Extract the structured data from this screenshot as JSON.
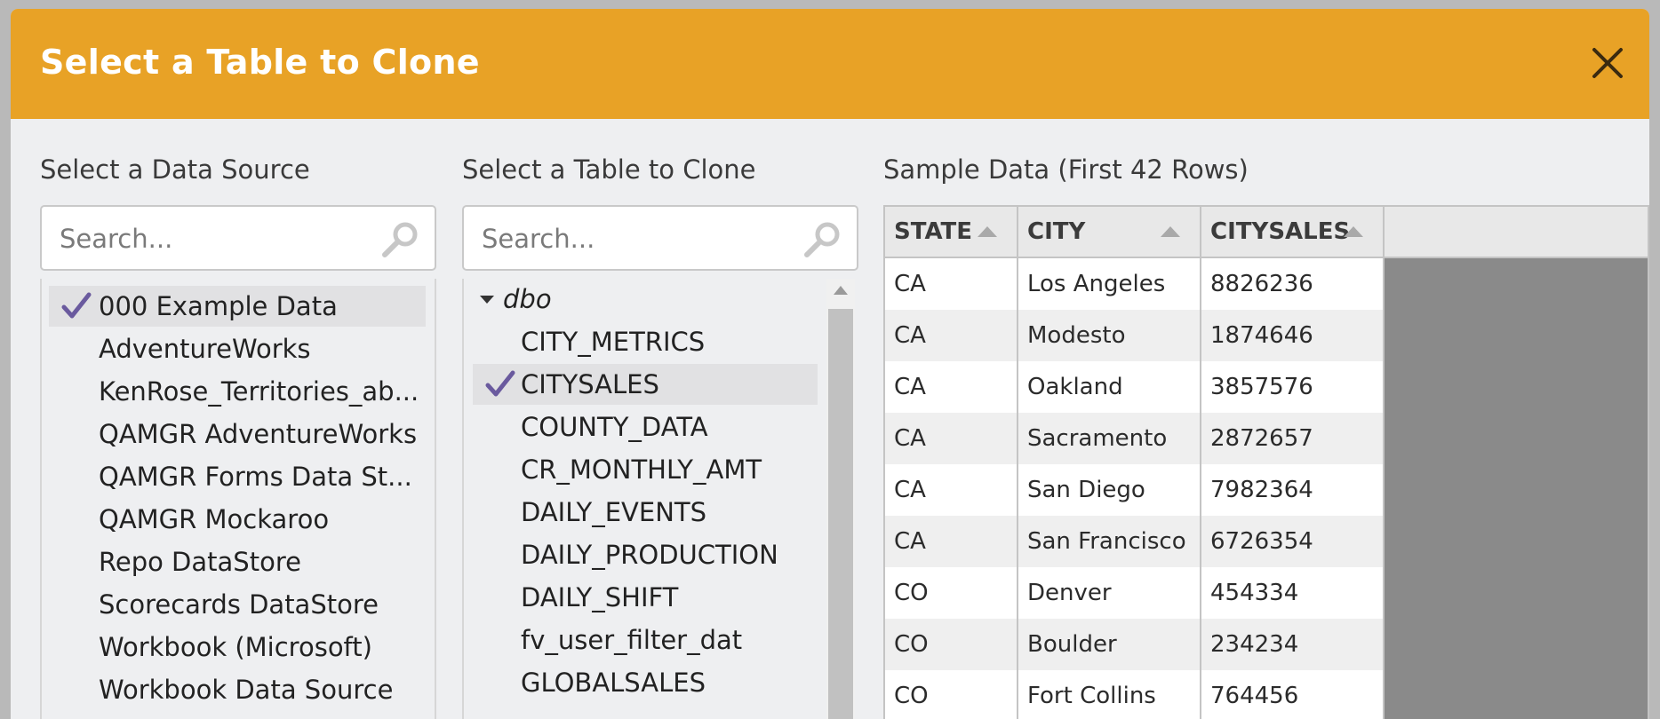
{
  "dialog": {
    "title": "Select a Table to Clone",
    "accent_color": "#e8a226"
  },
  "datasource": {
    "label": "Select a Data Source",
    "search_placeholder": "Search...",
    "items": [
      {
        "label": "000 Example Data",
        "selected": true
      },
      {
        "label": "AdventureWorks",
        "selected": false
      },
      {
        "label": "KenRose_Territories_ab...",
        "selected": false
      },
      {
        "label": "QAMGR AdventureWorks",
        "selected": false
      },
      {
        "label": "QAMGR Forms Data St...",
        "selected": false
      },
      {
        "label": "QAMGR Mockaroo",
        "selected": false
      },
      {
        "label": "Repo DataStore",
        "selected": false
      },
      {
        "label": "Scorecards DataStore",
        "selected": false
      },
      {
        "label": "Workbook (Microsoft)",
        "selected": false
      },
      {
        "label": "Workbook Data Source",
        "selected": false
      }
    ]
  },
  "tables": {
    "label": "Select a Table to Clone",
    "search_placeholder": "Search...",
    "schema": "dbo",
    "items": [
      {
        "label": "CITY_METRICS",
        "selected": false
      },
      {
        "label": "CITYSALES",
        "selected": true
      },
      {
        "label": "COUNTY_DATA",
        "selected": false
      },
      {
        "label": "CR_MONTHLY_AMT",
        "selected": false
      },
      {
        "label": "DAILY_EVENTS",
        "selected": false
      },
      {
        "label": "DAILY_PRODUCTION",
        "selected": false
      },
      {
        "label": "DAILY_SHIFT",
        "selected": false
      },
      {
        "label": "fv_user_filter_dat",
        "selected": false
      },
      {
        "label": "GLOBALSALES",
        "selected": false
      }
    ]
  },
  "sample": {
    "label": "Sample Data (First 42 Rows)",
    "columns": [
      "STATE",
      "CITY",
      "CITYSALES"
    ],
    "rows": [
      [
        "CA",
        "Los Angeles",
        "8826236"
      ],
      [
        "CA",
        "Modesto",
        "1874646"
      ],
      [
        "CA",
        "Oakland",
        "3857576"
      ],
      [
        "CA",
        "Sacramento",
        "2872657"
      ],
      [
        "CA",
        "San Diego",
        "7982364"
      ],
      [
        "CA",
        "San Francisco",
        "6726354"
      ],
      [
        "CO",
        "Denver",
        "454334"
      ],
      [
        "CO",
        "Boulder",
        "234234"
      ],
      [
        "CO",
        "Fort Collins",
        "764456"
      ]
    ]
  }
}
